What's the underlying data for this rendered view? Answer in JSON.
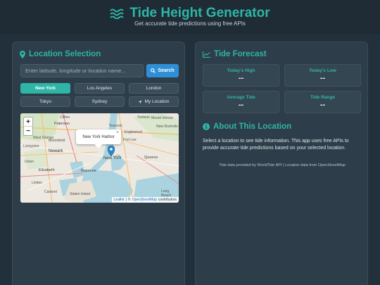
{
  "header": {
    "title": "Tide Height Generator",
    "subtitle": "Get accurate tide predictions using free APIs"
  },
  "location": {
    "title": "Location Selection",
    "search_placeholder": "Enter latitude, longitude or location name...",
    "search_button": "Search",
    "buttons": [
      "New York",
      "Los Angeles",
      "London",
      "Tokyo",
      "Sydney",
      "My Location"
    ],
    "active": "New York"
  },
  "map": {
    "zoom_in": "+",
    "zoom_out": "−",
    "popup": "New York Harbor",
    "popup_close": "×",
    "labels": [
      "Clifton",
      "Paterson",
      "Teaneck",
      "Englewood",
      "New Rochelle",
      "Fort Lee",
      "Mount Vernon",
      "Livingston",
      "Bloomfield",
      "Yonkers",
      "Newark",
      "West Orange",
      "Elizabeth",
      "Bayonne",
      "Linden",
      "Carteret",
      "Staten Island",
      "Union",
      "New York",
      "Queens",
      "Long Beach"
    ],
    "attribution": {
      "leaflet": "Leaflet",
      "sep": "|",
      "copy": "©",
      "osm": "OpenStreetMap",
      "contrib": "contributors"
    }
  },
  "forecast": {
    "title": "Tide Forecast",
    "stats": [
      {
        "label": "Today's High",
        "value": "--"
      },
      {
        "label": "Today's Low",
        "value": "--"
      },
      {
        "label": "Average Tide",
        "value": "--"
      },
      {
        "label": "Tide Range",
        "value": "--"
      }
    ]
  },
  "about": {
    "title": "About This Location",
    "text": "Select a location to see tide information. This app uses free APIs to provide accurate tide predictions based on your selected location.",
    "footer": "Tide data provided by WorldTide API | Location data from OpenStreetMap"
  },
  "colors": {
    "accent": "#2fb5a6",
    "primary_button": "#2f8fd6",
    "background": "#22303b",
    "panel": "#2d3d49"
  },
  "icons": {
    "title": "waves-icon",
    "location": "map-pin-icon",
    "search": "search-icon",
    "my_location": "location-arrow-icon",
    "forecast": "chart-line-icon",
    "about": "info-circle-icon",
    "marker": "map-marker-icon"
  }
}
